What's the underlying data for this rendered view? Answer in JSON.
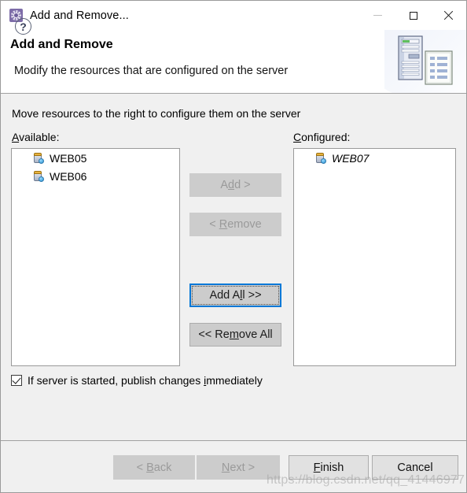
{
  "window": {
    "title": "Add and Remove...",
    "icon": "gear-icon",
    "controls": {
      "minimize": "minimize-icon",
      "maximize": "maximize-icon",
      "close": "close-icon"
    }
  },
  "header": {
    "title": "Add and Remove",
    "subtitle": "Modify the resources that are configured on the server",
    "banner_icon": "server-and-document-icon"
  },
  "content": {
    "instruction": "Move resources to the right to configure them on the server",
    "available": {
      "label_mnemonic": "A",
      "label_rest": "vailable:",
      "items": [
        {
          "name": "WEB05",
          "icon": "module-icon",
          "italic": false
        },
        {
          "name": "WEB06",
          "icon": "module-icon",
          "italic": false
        }
      ]
    },
    "configured": {
      "label_mnemonic": "C",
      "label_rest": "onfigured:",
      "items": [
        {
          "name": "WEB07",
          "icon": "module-icon",
          "italic": true
        }
      ]
    },
    "transfer_buttons": [
      {
        "id": "add",
        "pre": "A",
        "mnemonic": "d",
        "post": "d >",
        "state": "disabled"
      },
      {
        "id": "remove",
        "pre": "< ",
        "mnemonic": "R",
        "post": "emove",
        "state": "disabled"
      },
      {
        "id": "add-all",
        "pre": "Add A",
        "mnemonic": "l",
        "post": "l >>",
        "state": "focused"
      },
      {
        "id": "remove-all",
        "pre": "<< Re",
        "mnemonic": "m",
        "post": "ove All",
        "state": "enabled"
      }
    ],
    "publish_checkbox": {
      "checked": true,
      "pre": "If server is started, publish changes ",
      "mnemonic": "i",
      "post": "mmediately"
    }
  },
  "footer": {
    "help_icon": "help-icon",
    "help_glyph": "?",
    "buttons": [
      {
        "id": "back",
        "pre": "< ",
        "mnemonic": "B",
        "post": "ack",
        "state": "disabled"
      },
      {
        "id": "next",
        "pre": "",
        "mnemonic": "N",
        "post": "ext >",
        "state": "disabled"
      },
      {
        "id": "finish",
        "pre": "",
        "mnemonic": "F",
        "post": "inish",
        "state": "enabled"
      },
      {
        "id": "cancel",
        "pre": "Cancel",
        "mnemonic": "",
        "post": "",
        "state": "enabled"
      }
    ]
  },
  "watermark": "https://blog.csdn.net/qq_41446977",
  "colors": {
    "accent": "#0078d7",
    "title_icon": "#7d6ca8",
    "button_face": "#cccccc",
    "dialog_face": "#f0f0f0"
  }
}
